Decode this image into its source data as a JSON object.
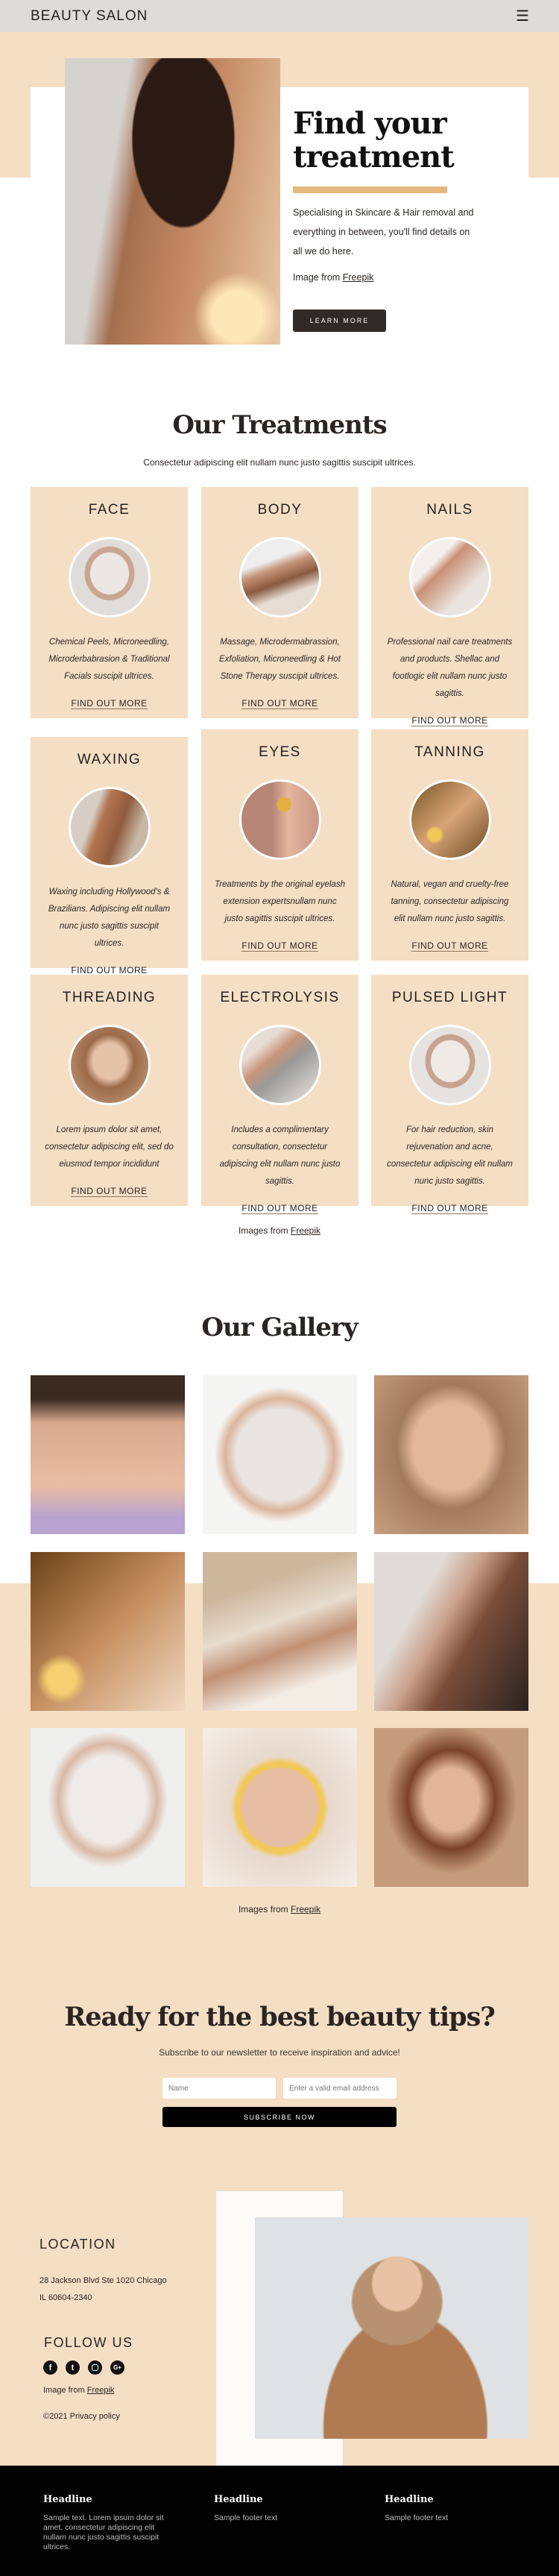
{
  "header": {
    "logo": "BEAUTY SALON",
    "menu_icon": "hamburger-icon"
  },
  "hero": {
    "title_line1": "Find your",
    "title_line2": "treatment",
    "text": "Specialising in Skincare & Hair removal and everything in between, you'll find details on all we do here.",
    "image_credit": "Image from",
    "image_credit_link": "Freepik",
    "button": "LEARN MORE",
    "accent_color": "#e5b87e"
  },
  "treatments": {
    "title": "Our Treatments",
    "subtitle": "Consectetur adipiscing elit nullam nunc justo sagittis suscipit ultrices.",
    "link_label": "FIND OUT MORE",
    "credit": "Images from",
    "credit_link": "Freepik",
    "cards": [
      {
        "title": "FACE",
        "desc": "Chemical Peels, Microneedling, Microderbabrasion & Traditional Facials suscipit ultrices."
      },
      {
        "title": "BODY",
        "desc": "Massage, Microdermabrassion, Exfoliation, Microneedling & Hot Stone Therapy  suscipit ultrices."
      },
      {
        "title": "NAILS",
        "desc": "Professional nail care treatments and products. Shellac and footlogic  elit nullam nunc justo sagittis."
      },
      {
        "title": "WAXING",
        "desc": "Waxing including Hollywood's & Brazilians. Adipiscing elit nullam nunc justo sagittis suscipit ultrices."
      },
      {
        "title": "EYES",
        "desc": "Treatments by the original eyelash extension expertsnullam nunc justo sagittis suscipit ultrices."
      },
      {
        "title": "TANNING",
        "desc": "Natural, vegan and cruelty-free tanning, consectetur adipiscing elit nullam nunc justo sagittis."
      },
      {
        "title": "THREADING",
        "desc": "Lorem ipsum dolor sit amet, consectetur adipiscing elit, sed do eiusmod tempor incididunt"
      },
      {
        "title": "ELECTROLYSIS",
        "desc": "Includes a complimentary consultation, consectetur adipiscing elit nullam nunc justo sagittis."
      },
      {
        "title": "PULSED LIGHT",
        "desc": "For hair reduction, skin rejuvenation and acne, consectetur adipiscing elit nullam nunc justo sagittis."
      }
    ]
  },
  "gallery": {
    "title": "Our Gallery",
    "credit": "Images from",
    "credit_link": "Freepik"
  },
  "newsletter": {
    "title": "Ready for the best beauty tips?",
    "subtitle": "Subscribe to our newsletter to receive inspiration and advice!",
    "name_placeholder": "Name",
    "email_placeholder": "Enter a valid email address",
    "button": "SUBSCRIBE NOW"
  },
  "contact": {
    "location_title": "LOCATION",
    "address1": "28 Jackson Blvd Ste 1020 Chicago",
    "address2": "IL 60604-2340",
    "follow_title": "FOLLOW US",
    "social": [
      "facebook-icon",
      "twitter-icon",
      "instagram-icon",
      "google-plus-icon"
    ],
    "credit": "Image from",
    "credit_link": "Freepik",
    "copyright": "©2021 Privacy policy"
  },
  "footer": {
    "cols": [
      {
        "headline": "Headline",
        "text": "Sample text. Lorem ipsum dolor sit amet, consectetur adipiscing elit nullam nunc justo sagittis suscipit ultrices."
      },
      {
        "headline": "Headline",
        "text": "Sample footer text"
      },
      {
        "headline": "Headline",
        "text": "Sample footer text"
      }
    ]
  }
}
